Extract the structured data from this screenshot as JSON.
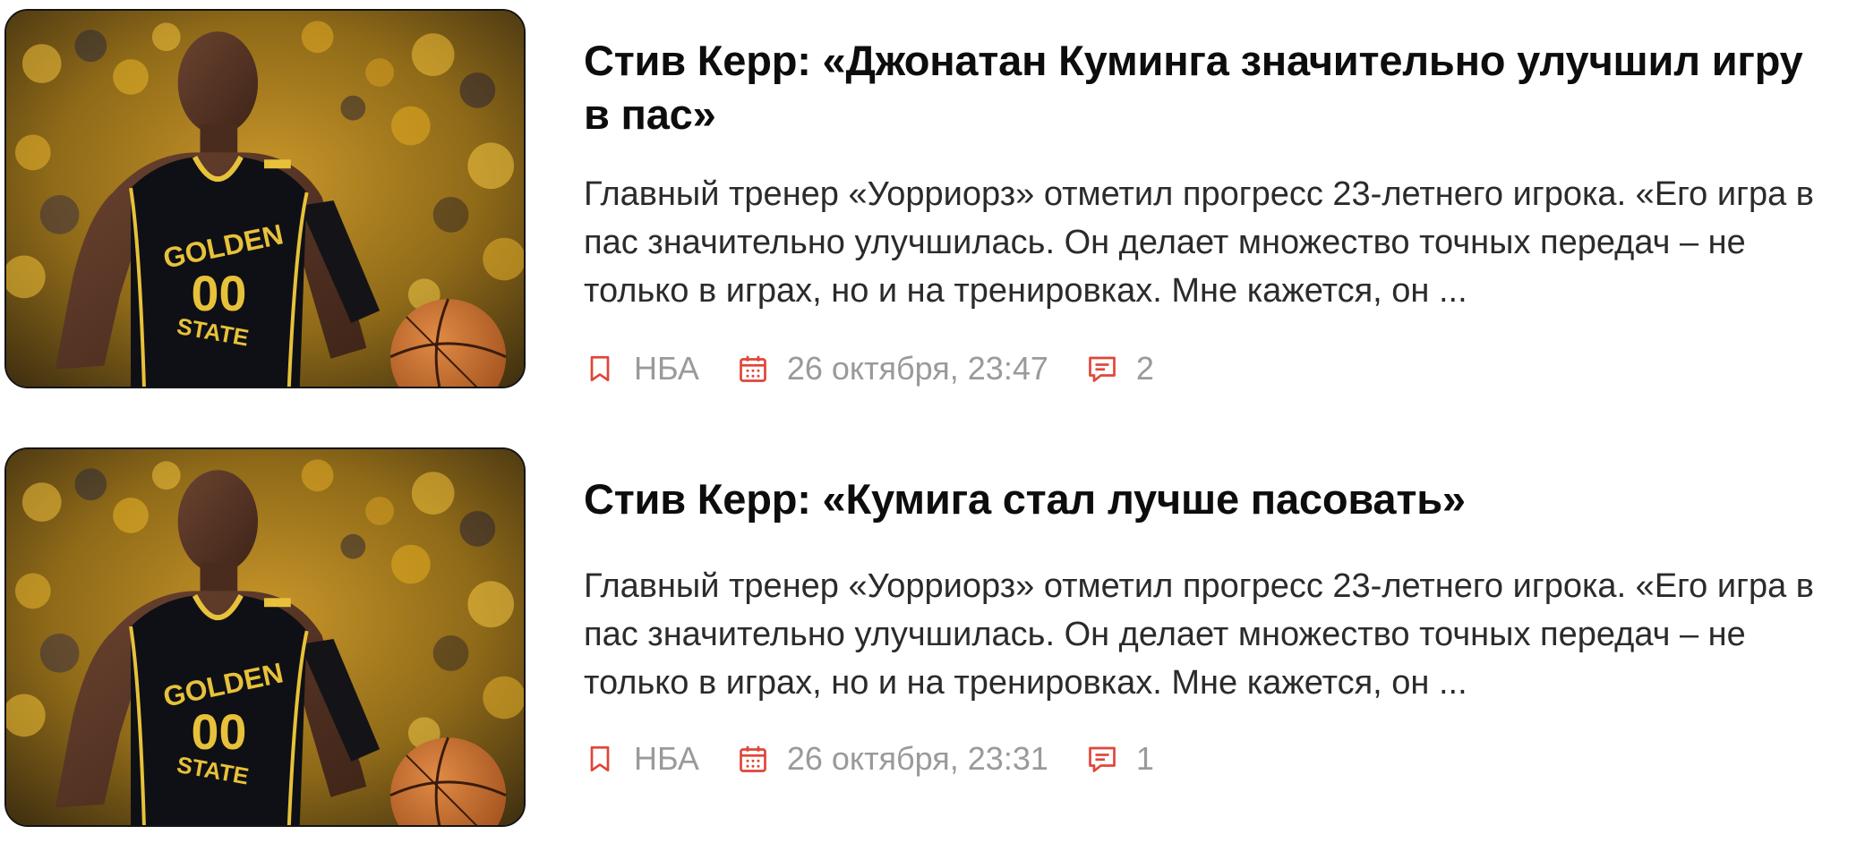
{
  "colors": {
    "accent": "#e0463a",
    "meta_text": "#9a9a9a",
    "title_text": "#0d0d0d",
    "excerpt_text": "#2b2b2b"
  },
  "articles": [
    {
      "title": "Стив Керр: «Джонатан Куминга значительно улучшил игру в пас»",
      "excerpt": "Главный тренер «Уорриорз» отметил прогресс 23-летнего игрока. «Его игра в пас значительно улучшилась. Он делает множество точных передач – не только в играх, но и на тренировках. Мне кажется, он ...",
      "tag": "НБА",
      "tag_icon": "bookmark-icon",
      "date": "26 октября, 23:47",
      "date_icon": "calendar-icon",
      "comments": "2",
      "comments_icon": "comment-icon",
      "image": {
        "jersey_brand": "GOLDEN",
        "jersey_state": "STATE",
        "jersey_number": "00"
      }
    },
    {
      "title": "Стив Керр: «Кумига стал лучше пасовать»",
      "excerpt": "Главный тренер «Уорриорз» отметил прогресс 23-летнего игрока. «Его игра в пас значительно улучшилась. Он делает множество точных передач – не только в играх, но и на тренировках. Мне кажется, он ...",
      "tag": "НБА",
      "tag_icon": "bookmark-icon",
      "date": "26 октября, 23:31",
      "date_icon": "calendar-icon",
      "comments": "1",
      "comments_icon": "comment-icon",
      "image": {
        "jersey_brand": "GOLDEN",
        "jersey_state": "STATE",
        "jersey_number": "00"
      }
    }
  ]
}
